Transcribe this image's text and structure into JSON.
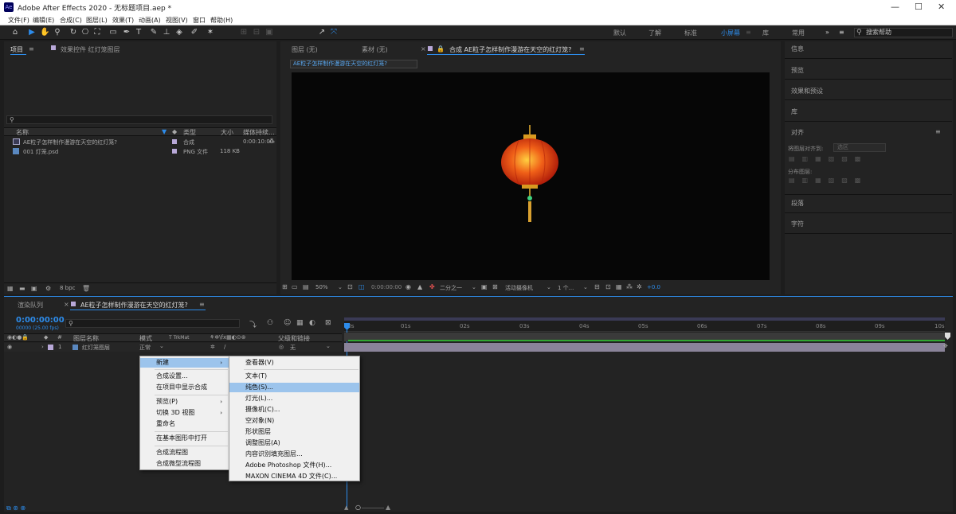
{
  "app": {
    "title": "Adobe After Effects 2020 - 无标题项目.aep *",
    "logo": "Ae"
  },
  "menubar": [
    "文件(F)",
    "编辑(E)",
    "合成(C)",
    "图层(L)",
    "效果(T)",
    "动画(A)",
    "视图(V)",
    "窗口",
    "帮助(H)"
  ],
  "toolbar": {
    "snap_label": "对齐",
    "workspaces": [
      "默认",
      "了解",
      "标准",
      "小屏幕",
      "库",
      "常用"
    ],
    "active_workspace": "小屏幕",
    "search_placeholder": "搜索帮助"
  },
  "project_panel": {
    "tab_label": "项目",
    "effects_tab_label": "效果控件 红灯笼图层",
    "columns": {
      "name": "名称",
      "type": "类型",
      "size": "大小",
      "duration": "媒体持续..."
    },
    "items": [
      {
        "name": "AE粒子怎样制作漫游在天空的红灯笼?",
        "type": "合成",
        "size": "",
        "duration": "0:00:10:00",
        "color": "#b8a8d8"
      },
      {
        "name": "001 灯笼.psd",
        "type": "PNG 文件",
        "size": "118 KB",
        "duration": "",
        "color": "#b8a8d8"
      }
    ],
    "bpc": "8 bpc"
  },
  "viewer": {
    "tabs": [
      "图层 (无)",
      "素材 (无)",
      "合成 AE粒子怎样制作漫游在天空的红灯笼?"
    ],
    "active_tab": "合成 AE粒子怎样制作漫游在天空的红灯笼?",
    "comp_chip": "AE粒子怎样制作漫游在天空的红灯笼?",
    "zoom": "50%",
    "timecode": "0:00:00:00",
    "resolution": "二分之一",
    "camera": "活动摄像机",
    "views": "1 个...",
    "exposure": "+0.0"
  },
  "right_panel": {
    "items": [
      "信息",
      "预览",
      "效果和预设",
      "库",
      "对齐",
      "段落",
      "字符"
    ],
    "align_to_label": "将图层对齐到:",
    "align_to_value": "选区",
    "distribute_label": "分布图层:"
  },
  "timeline": {
    "render_tab": "渲染队列",
    "comp_tab": "AE粒子怎样制作漫游在天空的红灯笼?",
    "timecode": "0:00:00:00",
    "timecode_sub": "00000 (25.00 fps)",
    "columns": {
      "hash": "#",
      "layer_name": "图层名称",
      "mode": "模式",
      "trkmat": "T TrkMat",
      "parent": "父级和链接"
    },
    "layer": {
      "index": "1",
      "name": "红灯笼图层",
      "mode": "正常",
      "parent": "无",
      "color": "#b8a8d8"
    },
    "ticks": [
      "00s",
      "01s",
      "02s",
      "03s",
      "04s",
      "05s",
      "06s",
      "07s",
      "08s",
      "09s",
      "10s"
    ]
  },
  "context_menu": {
    "items": [
      {
        "label": "新建",
        "submenu": true,
        "highlight": true
      },
      {
        "label": "合成设置..."
      },
      {
        "label": "在项目中显示合成"
      },
      {
        "label": "预览(P)",
        "submenu": true
      },
      {
        "label": "切换 3D 视图",
        "submenu": true
      },
      {
        "label": "重命名"
      },
      {
        "label": "在基本图形中打开"
      },
      {
        "label": "合成流程图"
      },
      {
        "label": "合成微型流程图"
      }
    ]
  },
  "submenu": {
    "items": [
      "查看器(V)",
      "文本(T)",
      "纯色(S)...",
      "灯光(L)...",
      "摄像机(C)...",
      "空对象(N)",
      "形状图层",
      "调整图层(A)",
      "内容识别填充图层...",
      "Adobe Photoshop 文件(H)...",
      "MAXON CINEMA 4D 文件(C)..."
    ],
    "highlight": "纯色(S)..."
  },
  "colors": {
    "accent": "#2d8ceb",
    "lantern": "#e03010",
    "label": "#b8a8d8"
  }
}
